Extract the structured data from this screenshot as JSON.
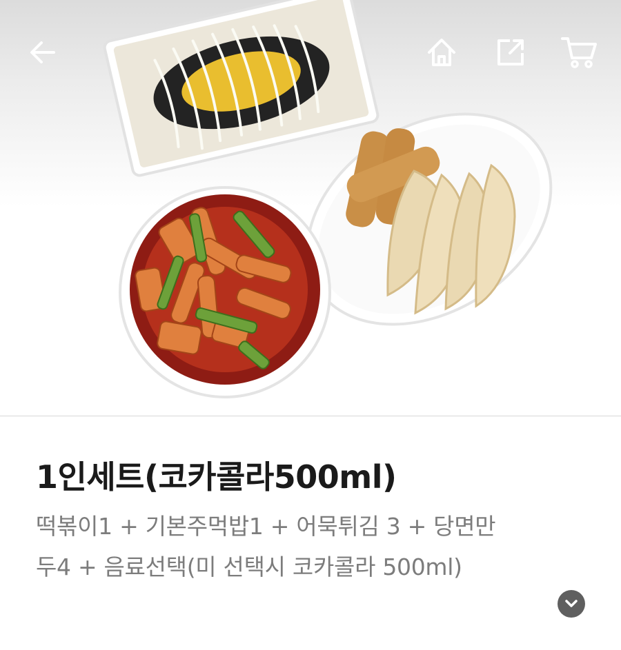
{
  "product": {
    "title": "1인세트(코카콜라500ml)",
    "description": "떡볶이1 + 기본주먹밥1 + 어묵튀김 3 + 당면만두4 + 음료선택(미 선택시 코카콜라 500ml)"
  },
  "icons": {
    "back": "arrow-left-icon",
    "home": "home-icon",
    "share": "share-icon",
    "cart": "cart-icon",
    "expand": "chevron-down-icon"
  },
  "colors": {
    "title": "#1a1a1a",
    "description": "#7c7c7c",
    "expand_button": "#5f5f5f",
    "toolbar_icon": "#ffffff"
  }
}
